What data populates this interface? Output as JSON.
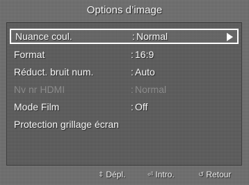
{
  "menu": {
    "title": "Options d’image",
    "separator": ":",
    "items": [
      {
        "label": "Nuance coul.",
        "value": "Normal"
      },
      {
        "label": "Format",
        "value": "16:9"
      },
      {
        "label": "Réduct. bruit num.",
        "value": "Auto"
      },
      {
        "label": "Nv nr HDMI",
        "value": "Normal"
      },
      {
        "label": "Mode Film",
        "value": "Off"
      },
      {
        "label": "Protection grillage écran",
        "value": ""
      }
    ]
  },
  "footer": {
    "move_icon": "updown-arrow-icon",
    "move_label": "Dépl.",
    "enter_icon": "enter-icon",
    "enter_label": "Intro.",
    "return_icon": "return-icon",
    "return_label": "Retour"
  },
  "colors": {
    "background": "#6e6e6e",
    "panel": "#585858",
    "text": "#f6f6f6",
    "disabled_text": "#8a8a8a",
    "highlight_border": "#ffffff"
  }
}
